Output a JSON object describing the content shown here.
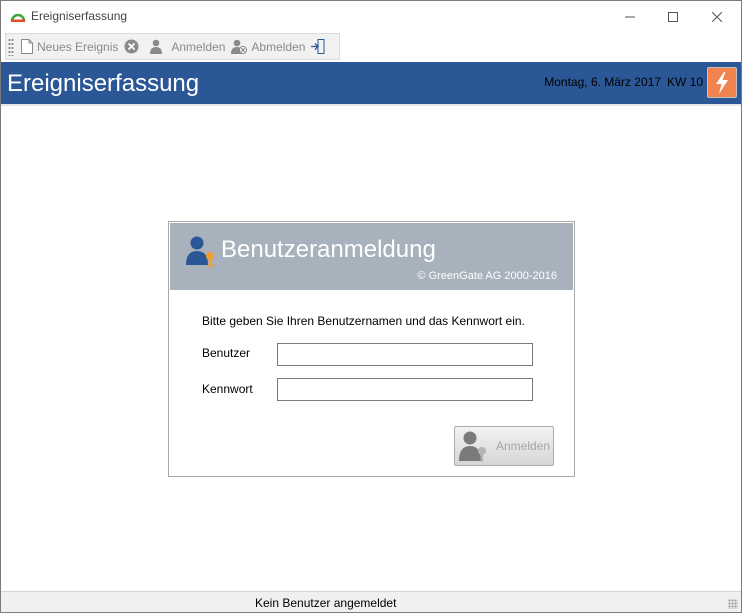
{
  "window": {
    "title": "Ereigniserfassung"
  },
  "toolbar": {
    "items": [
      {
        "label": "Neues Ereignis",
        "icon": "new-document-icon"
      },
      {
        "label": "",
        "icon": "cancel-circle-icon"
      },
      {
        "label": "Anmelden",
        "icon": "user-login-icon"
      },
      {
        "label": "Abmelden",
        "icon": "user-logout-icon"
      },
      {
        "label": "",
        "icon": "exit-door-icon"
      }
    ]
  },
  "header": {
    "title": "Ereigniserfassung",
    "date": "Montag, 6. März 2017",
    "week": "KW 10",
    "bolt_icon": "lightning-bolt-icon",
    "color": "#2b5797",
    "accent": "#f0834e"
  },
  "login": {
    "title": "Benutzeranmeldung",
    "copyright": "© GreenGate AG 2000-2016",
    "instruction": "Bitte geben Sie Ihren Benutzernamen und das Kennwort ein.",
    "user_label": "Benutzer",
    "user_value": "",
    "password_label": "Kennwort",
    "password_value": "",
    "button_label": "Anmelden",
    "header_color": "#a7b2bd"
  },
  "status": {
    "text": "Kein Benutzer angemeldet"
  }
}
